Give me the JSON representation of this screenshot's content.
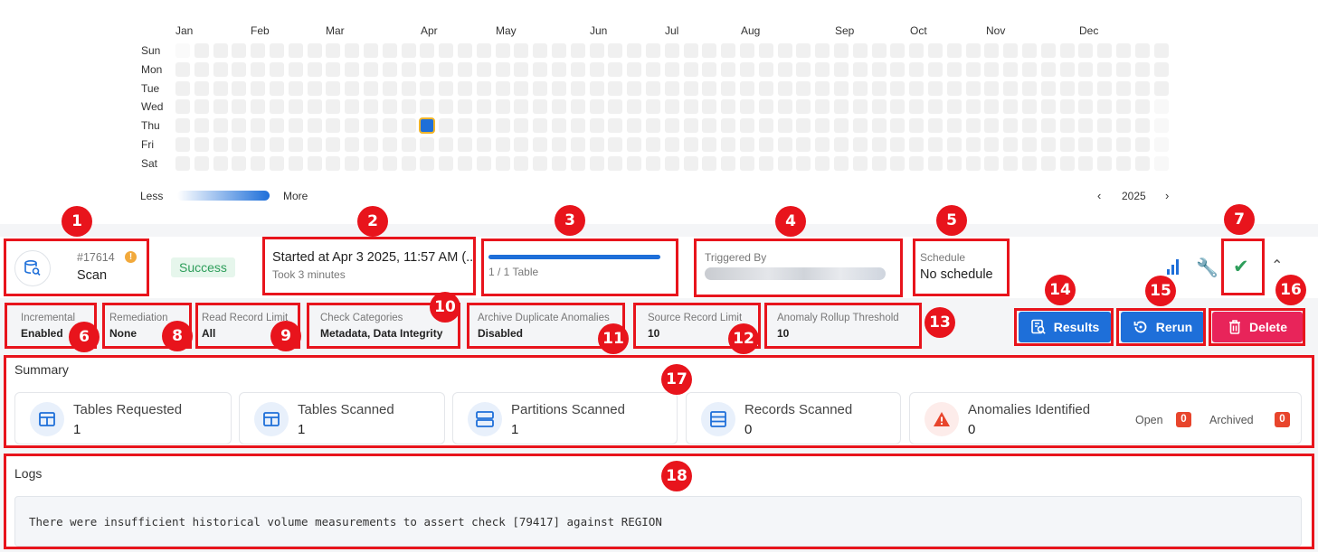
{
  "heatmap": {
    "months": [
      "Jan",
      "Feb",
      "Mar",
      "Apr",
      "May",
      "Jun",
      "Jul",
      "Aug",
      "Sep",
      "Oct",
      "Nov",
      "Dec"
    ],
    "days": [
      "Sun",
      "Mon",
      "Tue",
      "Wed",
      "Thu",
      "Fri",
      "Sat"
    ],
    "legend_less": "Less",
    "legend_more": "More",
    "year": "2025",
    "prev_icon": "chevron-left-icon",
    "next_icon": "chevron-right-icon",
    "active_color": "#1e6fd9"
  },
  "operation": {
    "id": "#17614",
    "type": "Scan",
    "status": "Success",
    "started": "Started at Apr 3 2025, 11:57 AM (...",
    "duration": "Took 3 minutes",
    "progress_text": "1 / 1 Table",
    "progress_fraction": 1.0,
    "triggered_by_label": "Triggered By",
    "schedule_label": "Schedule",
    "schedule_value": "No schedule"
  },
  "settings": [
    {
      "label": "Incremental",
      "value": "Enabled"
    },
    {
      "label": "Remediation",
      "value": "None"
    },
    {
      "label": "Read Record Limit",
      "value": "All"
    },
    {
      "label": "Check Categories",
      "value": "Metadata, Data Integrity"
    },
    {
      "label": "Archive Duplicate Anomalies",
      "value": "Disabled"
    },
    {
      "label": "Source Record Limit",
      "value": "10"
    },
    {
      "label": "Anomaly Rollup Threshold",
      "value": "10"
    }
  ],
  "buttons": {
    "results": "Results",
    "rerun": "Rerun",
    "delete": "Delete"
  },
  "summary": {
    "title": "Summary",
    "cards": [
      {
        "title": "Tables Requested",
        "value": "1"
      },
      {
        "title": "Tables Scanned",
        "value": "1"
      },
      {
        "title": "Partitions Scanned",
        "value": "1"
      },
      {
        "title": "Records Scanned",
        "value": "0"
      },
      {
        "title": "Anomalies Identified",
        "value": "0"
      }
    ],
    "open_label": "Open",
    "open_count": "0",
    "archived_label": "Archived",
    "archived_count": "0"
  },
  "logs": {
    "title": "Logs",
    "message": "There were insufficient historical volume measurements to assert check [79417] against REGION"
  },
  "callouts": [
    "1",
    "2",
    "3",
    "4",
    "5",
    "6",
    "7",
    "8",
    "9",
    "10",
    "11",
    "12",
    "13",
    "14",
    "15",
    "16",
    "17",
    "18"
  ],
  "colors": {
    "annotation": "#e8141c",
    "primary": "#1e6fd9",
    "delete": "#e8245a",
    "success_bg": "#e6f6ec",
    "success_text": "#2e9e5b"
  }
}
